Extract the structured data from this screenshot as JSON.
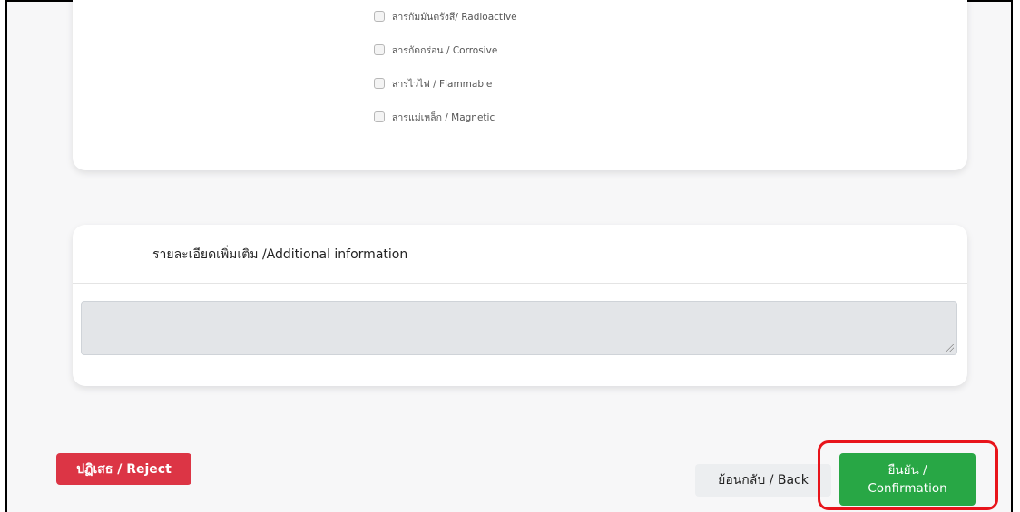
{
  "hazard_options": [
    {
      "label": "สารกัมมันตรังสี/ Radioactive",
      "checked": false
    },
    {
      "label": "สารกัดกร่อน / Corrosive",
      "checked": false
    },
    {
      "label": "สารไวไฟ / Flammable",
      "checked": false
    },
    {
      "label": "สารแม่เหล็ก / Magnetic",
      "checked": false
    }
  ],
  "additional_info": {
    "title": "รายละเอียดเพิ่มเติม /Additional information",
    "value": ""
  },
  "actions": {
    "reject_label": "ปฏิเสธ / Reject",
    "back_label": "ย้อนกลับ / Back",
    "confirm_line1": "ยืนยัน /",
    "confirm_line2": "Confirmation"
  },
  "colors": {
    "reject": "#dc3545",
    "confirm": "#28a745",
    "highlight": "#e8141b"
  }
}
